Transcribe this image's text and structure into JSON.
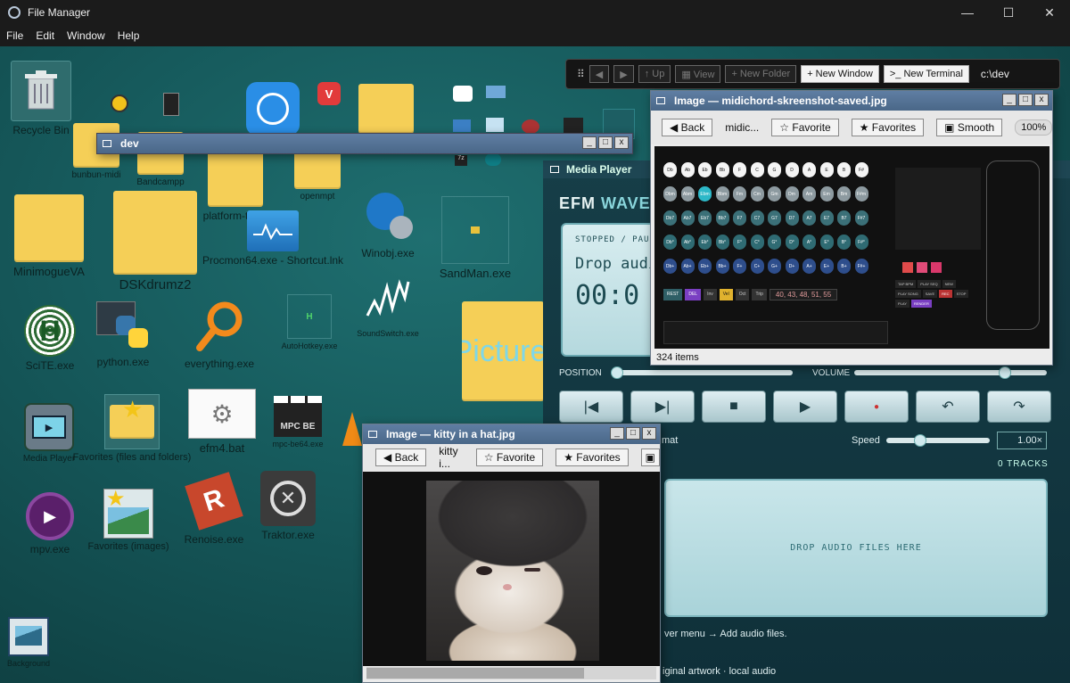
{
  "os_window": {
    "title": "File Manager",
    "menu": [
      "File",
      "Edit",
      "Window",
      "Help"
    ],
    "controls": {
      "minimize": "—",
      "maximize": "☐",
      "close": "✕"
    }
  },
  "desktop_icons": [
    {
      "label": "Recycle Bin"
    },
    {
      "label": "bunbun-midi"
    },
    {
      "label": "Bandcampp"
    },
    {
      "label": "platform-tools"
    },
    {
      "label": "openmpt"
    },
    {
      "label": "MinimogueVA"
    },
    {
      "label": "DSKdrumz2"
    },
    {
      "label": "Procmon64.exe - Shortcut.lnk"
    },
    {
      "label": "Winobj.exe"
    },
    {
      "label": "SandMan.exe"
    },
    {
      "label": "SciTE.exe"
    },
    {
      "label": "python.exe"
    },
    {
      "label": "everything.exe"
    },
    {
      "label": "AutoHotkey.exe"
    },
    {
      "label": "SoundSwitch.exe"
    },
    {
      "label": "Pictures"
    },
    {
      "label": "Media Player"
    },
    {
      "label": "Favorites (files and folders)"
    },
    {
      "label": "efm4.bat"
    },
    {
      "label": "mpc-be64.exe"
    },
    {
      "label": "mpv.exe"
    },
    {
      "label": "Favorites (images)"
    },
    {
      "label": "Renoise.exe"
    },
    {
      "label": "Traktor.exe"
    },
    {
      "label": "Background"
    }
  ],
  "icon_glyphs": {
    "mpc": "MPC BE",
    "autohotkey": "H",
    "renoise": "R"
  },
  "pathbar": {
    "up": "↑ Up",
    "view": "▦ View",
    "new_folder": "+ New Folder",
    "new_window": "+ New Window",
    "new_terminal": ">_ New Terminal",
    "path": "c:\\dev",
    "nav_back": "◀",
    "nav_forward": "▶",
    "grip": "⠿"
  },
  "dev_window": {
    "title": "dev"
  },
  "media_player": {
    "title": "Media Player",
    "brand_a": "EFM ",
    "brand_b": "WAVE",
    "status": "STOPPED / PAU",
    "drop_msg": "Drop audi",
    "time": "00:0",
    "position_label": "POSITION",
    "volume_label": "VOLUME",
    "position": 0.0,
    "volume": 0.8,
    "speed_label": "Speed",
    "speed_value": "1.00×",
    "speed": 0.3,
    "format_label": "mat",
    "tracks_label": "0 TRACKS",
    "dropzone": "DROP AUDIO FILES HERE",
    "hint": "ver menu → Add audio files.",
    "footer": "iginal artwork · local audio",
    "controls": [
      "|◀",
      "▶|",
      "■",
      "▶",
      "●",
      "↶",
      "↷"
    ]
  },
  "image_viewer_1": {
    "title": "Image — midichord-skreenshot-saved.jpg",
    "back": "◀ Back",
    "name": "midic...",
    "favorite": "☆ Favorite",
    "favorites": "★ Favorites",
    "smooth": "▣ Smooth",
    "zoom": "100%",
    "status": "324 items",
    "chord_numbers": "40, 43, 48, 51, 55",
    "chord_buttons": [
      [
        "Db",
        "Ab",
        "Eb",
        "Bb",
        "F",
        "C",
        "G",
        "D",
        "A",
        "E",
        "B",
        "F#"
      ],
      [
        "Dbm",
        "Abm",
        "Ebm",
        "Bbm",
        "Fm",
        "Cm",
        "Gm",
        "Dm",
        "Am",
        "Em",
        "Bm",
        "F#m"
      ],
      [
        "Db7",
        "Ab7",
        "Eb7",
        "Bb7",
        "F7",
        "C7",
        "G7",
        "D7",
        "A7",
        "E7",
        "B7",
        "F#7"
      ],
      [
        "Db°",
        "Ab°",
        "Eb°",
        "Bb°",
        "F°",
        "C°",
        "G°",
        "D°",
        "A°",
        "E°",
        "B°",
        "F#°"
      ],
      [
        "Db+",
        "Ab+",
        "Eb+",
        "Bb+",
        "F+",
        "C+",
        "G+",
        "D+",
        "A+",
        "E+",
        "B+",
        "F#+"
      ]
    ],
    "small_buttons": [
      "REST",
      "DEL",
      "Inv",
      "Vel",
      "Oct",
      "Trip"
    ],
    "side_buttons": [
      "TAP BPM",
      "PLAY SEQ",
      "NEW",
      "PLAY SONG",
      "SAVE",
      "REC",
      "STOP",
      "PLAY",
      "RENDER"
    ]
  },
  "image_viewer_2": {
    "title": "Image — kitty in a hat.jpg",
    "back": "◀ Back",
    "name": "kitty i...",
    "favorite": "☆ Favorite",
    "favorites": "★ Favorites",
    "smooth": "▣",
    "scroll": 0.75
  },
  "window_buttons": {
    "min": "_",
    "max": "□",
    "close": "x"
  },
  "colors": {
    "folder": "#f5cf57",
    "accent": "#4a6788"
  }
}
